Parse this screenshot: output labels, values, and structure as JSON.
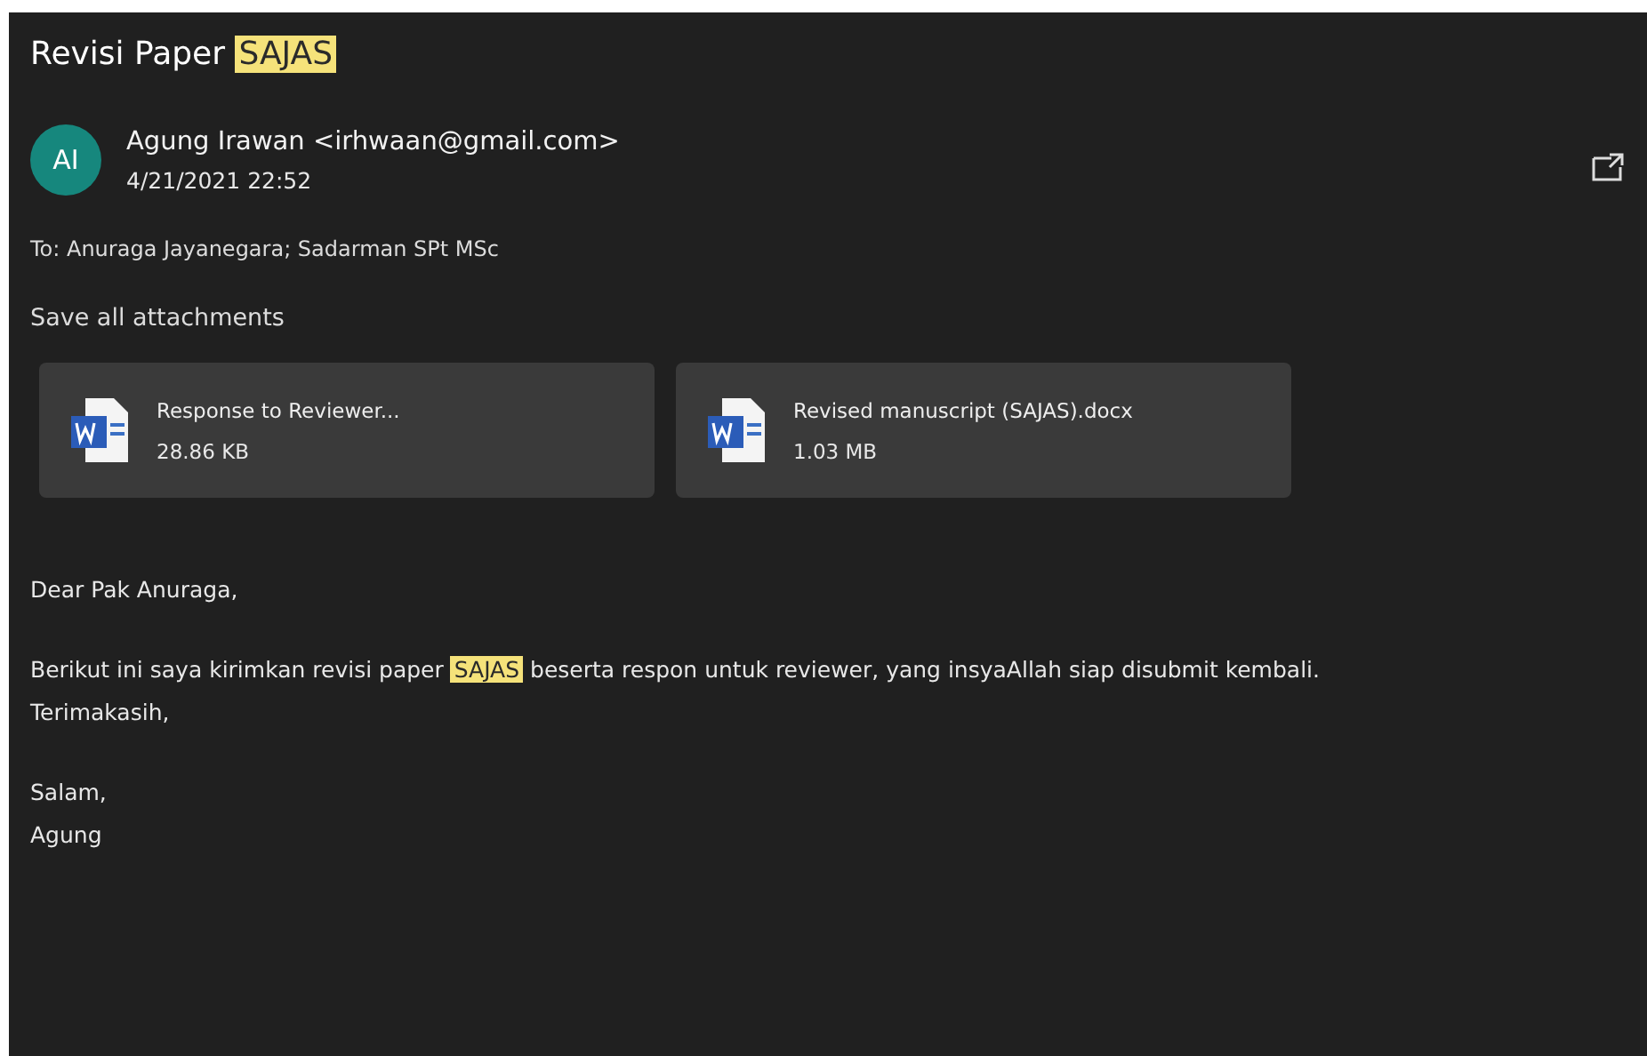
{
  "subject": [
    {
      "text": "Revisi Paper ",
      "highlight": false
    },
    {
      "text": "SAJAS",
      "highlight": true
    }
  ],
  "sender": {
    "initials": "AI",
    "name": "Agung Irawan <irhwaan@gmail.com>",
    "date": "4/21/2021 22:52"
  },
  "recipients": "To: Anuraga Jayanegara; Sadarman SPt MSc",
  "save_all": "Save all attachments",
  "attachments": [
    {
      "name": "Response to Reviewer...",
      "size": "28.86 KB"
    },
    {
      "name": "Revised manuscript (SAJAS).docx",
      "size": "1.03 MB"
    }
  ],
  "body": [
    [
      {
        "text": "Dear Pak Anuraga,",
        "highlight": false
      }
    ],
    [
      {
        "text": "Berikut ini saya kirimkan revisi paper ",
        "highlight": false
      },
      {
        "text": "SAJAS",
        "highlight": true
      },
      {
        "text": " beserta respon untuk reviewer, yang insyaAllah siap disubmit kembali.",
        "highlight": false
      }
    ],
    [
      {
        "text": "Terimakasih,",
        "highlight": false
      }
    ],
    [
      {
        "text": "Salam,",
        "highlight": false
      }
    ],
    [
      {
        "text": "Agung",
        "highlight": false
      }
    ]
  ]
}
